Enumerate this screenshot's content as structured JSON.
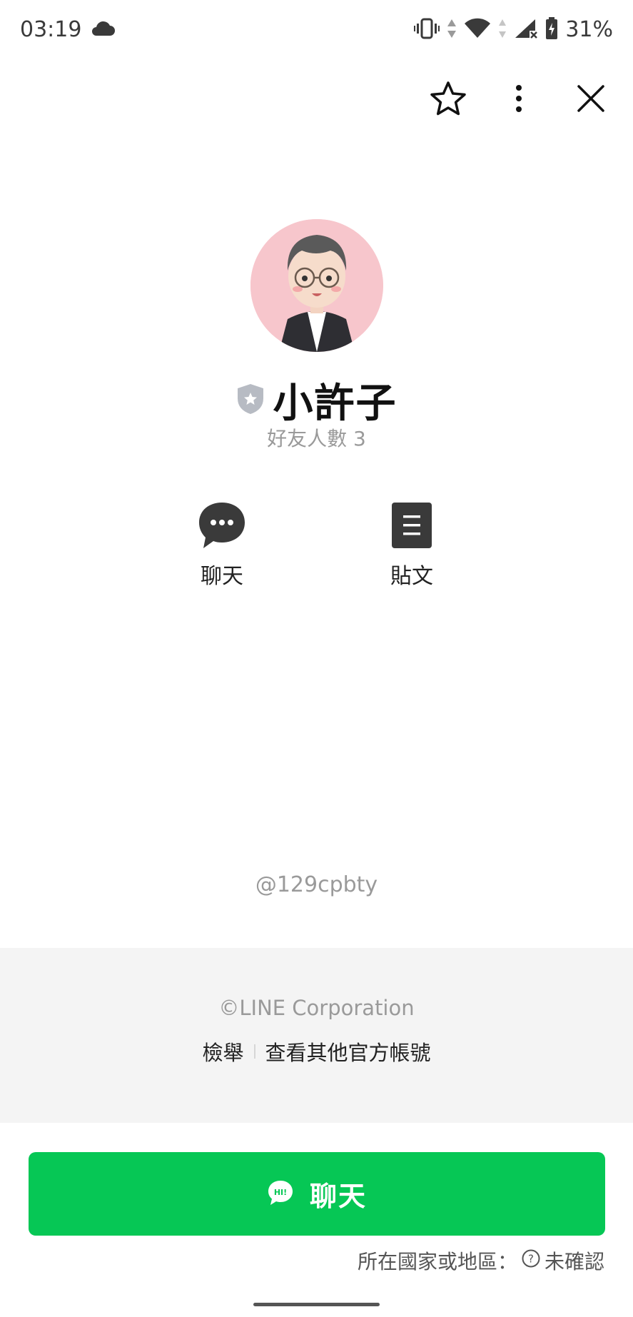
{
  "status_bar": {
    "time": "03:19",
    "battery": "31%",
    "icons": [
      "cloud-icon",
      "vibrate-icon",
      "wifi-icon",
      "signal-icon",
      "battery-icon"
    ]
  },
  "top_bar": {
    "icons": [
      "star-icon",
      "more-vertical-icon",
      "close-icon"
    ]
  },
  "profile": {
    "name": "小許子",
    "friends_count": "好友人數 3",
    "badge_icon": "shield-icon"
  },
  "actions": {
    "chat_label": "聊天",
    "posts_label": "貼文"
  },
  "line_id": "@129cpbty",
  "footer": {
    "copyright": "©LINE Corporation",
    "report": "檢舉",
    "other_accounts": "查看其他官方帳號"
  },
  "bottom": {
    "chat_button_label": "聊天",
    "region_label": "所在國家或地區：",
    "region_value": "未確認"
  },
  "colors": {
    "accent_green": "#06c755",
    "footer_bg": "#f4f4f4",
    "avatar_bg": "#f7c6cc"
  }
}
